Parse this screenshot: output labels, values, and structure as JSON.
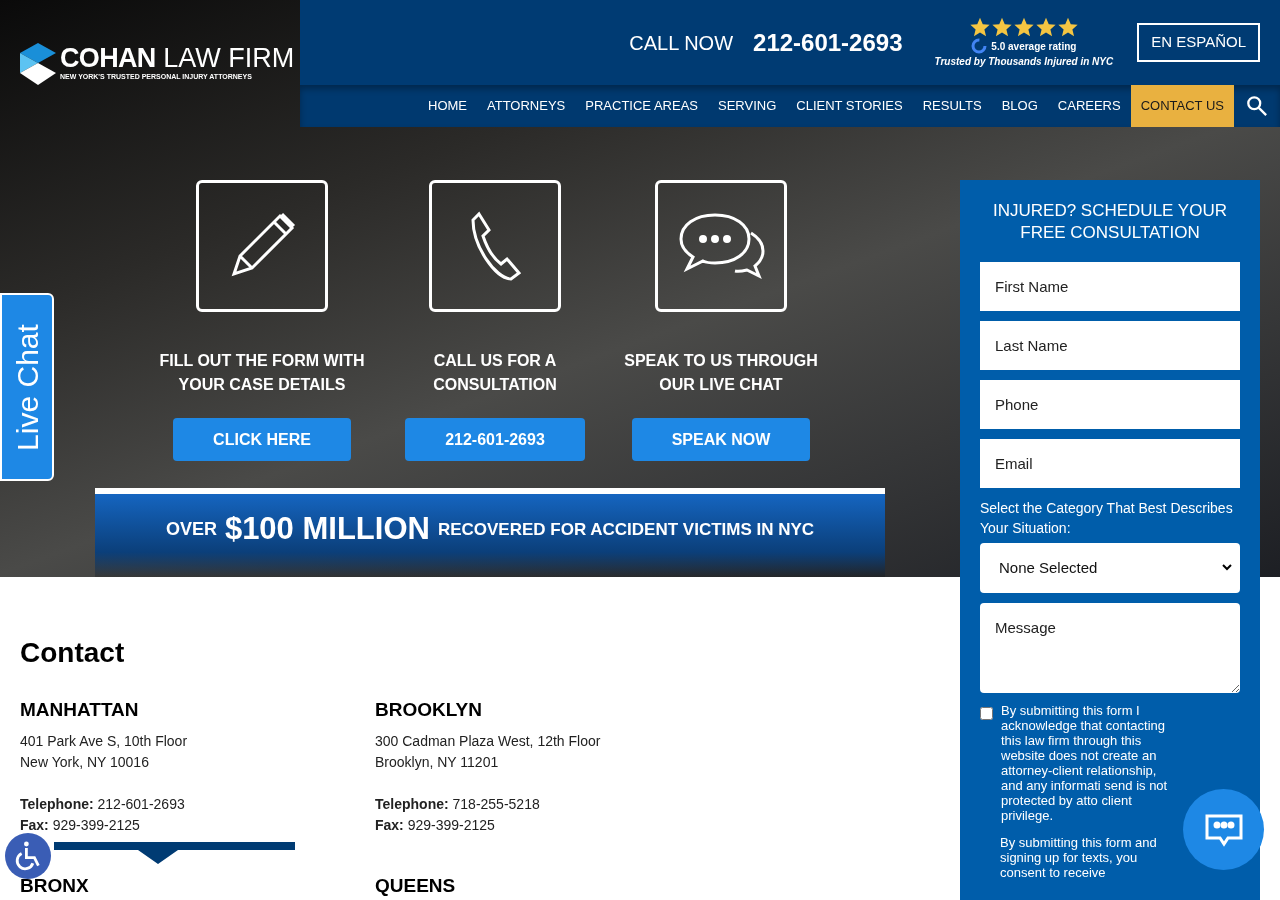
{
  "logo": {
    "name_bold": "COHAN",
    "name_light": "LAW FIRM",
    "tagline": "NEW YORK'S TRUSTED PERSONAL INJURY ATTORNEYS"
  },
  "header": {
    "call_label": "CALL NOW",
    "phone": "212-601-2693",
    "rating": {
      "stars": 5,
      "text": "5.0 average rating",
      "subtext": "Trusted by Thousands Injured in NYC"
    },
    "language_button": "EN ESPAÑOL"
  },
  "nav": [
    {
      "label": "HOME",
      "selected": false
    },
    {
      "label": "ATTORNEYS",
      "selected": false
    },
    {
      "label": "PRACTICE AREAS",
      "selected": false
    },
    {
      "label": "SERVING",
      "selected": false
    },
    {
      "label": "CLIENT STORIES",
      "selected": false
    },
    {
      "label": "RESULTS",
      "selected": false
    },
    {
      "label": "BLOG",
      "selected": false
    },
    {
      "label": "CAREERS",
      "selected": false
    },
    {
      "label": "CONTACT US",
      "selected": true
    }
  ],
  "hero": {
    "options": [
      {
        "kind": "pen",
        "title": "FILL OUT THE FORM WITH YOUR CASE DETAILS",
        "button": "CLICK HERE"
      },
      {
        "kind": "phone",
        "title": "CALL US FOR A CONSULTATION",
        "button": "212-601-2693"
      },
      {
        "kind": "chat",
        "title": "SPEAK TO US THROUGH OUR LIVE CHAT",
        "button": "SPEAK NOW"
      }
    ],
    "banner": {
      "prefix": "OVER",
      "amount": "$100 MILLION",
      "suffix": "RECOVERED FOR ACCIDENT VICTIMS IN NYC"
    }
  },
  "live_chat_tab": "Live Chat",
  "form": {
    "title": "INJURED? SCHEDULE YOUR FREE CONSULTATION",
    "fields": [
      {
        "placeholder": "First Name"
      },
      {
        "placeholder": "Last Name"
      },
      {
        "placeholder": "Phone"
      },
      {
        "placeholder": "Email"
      }
    ],
    "category_label": "Select the Category That Best Describes Your Situation:",
    "category_value": "None Selected",
    "message_placeholder": "Message",
    "consent": {
      "checked": false,
      "text": "By submitting this form I acknowledge that contacting this law firm through this website does not create an attorney-client relationship, and any informati send is not protected by atto client privilege."
    },
    "sms_text": "By submitting this form and signing up for texts, you consent to receive"
  },
  "contact": {
    "title": "Contact",
    "offices": [
      {
        "name": "MANHATTAN",
        "address_1": "401 Park Ave S, 10th Floor",
        "address_2": "New York, NY 10016",
        "telephone_label": "Telephone:",
        "telephone": "212-601-2693",
        "fax_label": "Fax:",
        "fax": "929-399-2125"
      },
      {
        "name": "BROOKLYN",
        "address_1": "300 Cadman Plaza West, 12th Floor",
        "address_2": "Brooklyn, NY 11201",
        "telephone_label": "Telephone:",
        "telephone": "718-255-5218",
        "fax_label": "Fax:",
        "fax": "929-399-2125"
      }
    ],
    "next_offices": [
      "BRONX",
      "QUEENS"
    ]
  }
}
